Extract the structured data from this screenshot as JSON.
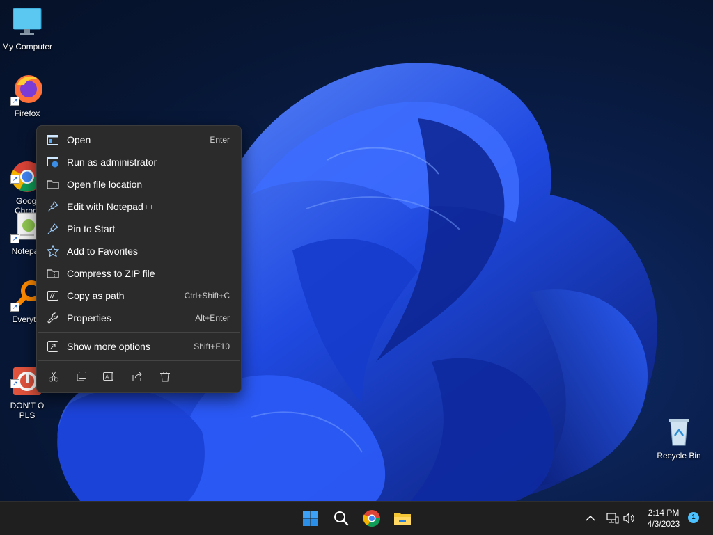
{
  "desktop": {
    "icons": [
      {
        "name": "my-computer",
        "label": "My Computer"
      },
      {
        "name": "firefox",
        "label": "Firefox"
      },
      {
        "name": "google-chrome",
        "label": "Googl\nChrom"
      },
      {
        "name": "notepad",
        "label": "Notepac"
      },
      {
        "name": "everything",
        "label": "Everythi"
      },
      {
        "name": "dont-open",
        "label": "DON'T O\nPLS"
      },
      {
        "name": "recycle-bin",
        "label": "Recycle Bin"
      }
    ]
  },
  "context_menu": {
    "items": [
      {
        "label": "Open",
        "shortcut": "Enter",
        "icon": "window-icon"
      },
      {
        "label": "Run as administrator",
        "shortcut": "",
        "icon": "shield-window-icon"
      },
      {
        "label": "Open file location",
        "shortcut": "",
        "icon": "folder-icon"
      },
      {
        "label": "Edit with Notepad++",
        "shortcut": "",
        "icon": "pin-icon"
      },
      {
        "label": "Pin to Start",
        "shortcut": "",
        "icon": "pin-icon"
      },
      {
        "label": "Add to Favorites",
        "shortcut": "",
        "icon": "star-icon"
      },
      {
        "label": "Compress to ZIP file",
        "shortcut": "",
        "icon": "zip-folder-icon"
      },
      {
        "label": "Copy as path",
        "shortcut": "Ctrl+Shift+C",
        "icon": "copy-path-icon"
      },
      {
        "label": "Properties",
        "shortcut": "Alt+Enter",
        "icon": "wrench-icon"
      }
    ],
    "more": {
      "label": "Show more options",
      "shortcut": "Shift+F10",
      "icon": "expand-icon"
    },
    "actions": [
      "cut-icon",
      "copy-icon",
      "rename-icon",
      "share-icon",
      "delete-icon"
    ]
  },
  "taskbar": {
    "buttons": [
      "start-icon",
      "search-icon",
      "chrome-icon",
      "file-explorer-icon"
    ],
    "tray": [
      "chevron-up-icon",
      "network-icon",
      "volume-icon"
    ],
    "time": "2:14 PM",
    "date": "4/3/2023",
    "notification_count": "1"
  },
  "colors": {
    "menu_bg": "#2b2b2b",
    "taskbar_bg": "#1f1f1f",
    "accent": "#4cc2ff"
  }
}
